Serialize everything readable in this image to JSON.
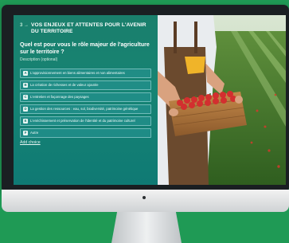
{
  "form": {
    "section_number": "3 →",
    "section_title": "VOS ENJEUX ET ATTENTES POUR L'AVENIR DU TERRITOIRE",
    "question": "Quel est pour vous le rôle majeur de l'agriculture sur le territoire ?",
    "hint": "Description (optional)",
    "choices": [
      {
        "key": "A",
        "label": "L'approvisionnement en biens alimentaires et non alimentaires"
      },
      {
        "key": "B",
        "label": "La création de richesses et de valeur ajoutée"
      },
      {
        "key": "C",
        "label": "L'entretien et façonnage des paysages"
      },
      {
        "key": "D",
        "label": "La gestion des ressources : eau, sol, biodiversité, patrimoine génétique"
      },
      {
        "key": "E",
        "label": "L'enrichissement et préservation de l'identité et du patrimoine culturel"
      },
      {
        "key": "F",
        "label": "Autre"
      }
    ],
    "add_choice": "Add choice"
  }
}
